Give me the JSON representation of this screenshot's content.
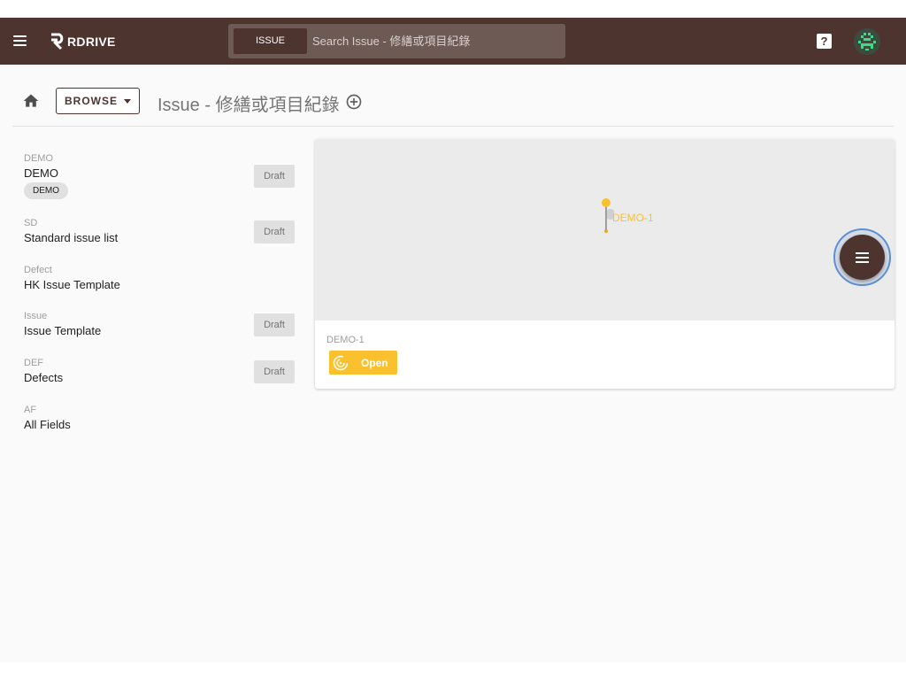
{
  "app": {
    "logo_text": "RDRIVE"
  },
  "search": {
    "scope_label": "ISSUE",
    "placeholder": "Search Issue - 修繕或項目紀錄"
  },
  "help": {
    "label": "?"
  },
  "toolbar": {
    "browse_label": "BROWSE",
    "page_title": "Issue - 修繕或項目紀錄"
  },
  "templates": [
    {
      "code": "DEMO",
      "name": "DEMO",
      "tag": "DEMO",
      "status": "Draft"
    },
    {
      "code": "SD",
      "name": "Standard issue list",
      "status": "Draft"
    },
    {
      "code": "Defect",
      "name": "HK Issue Template"
    },
    {
      "code": "Issue",
      "name": "Issue Template",
      "status": "Draft"
    },
    {
      "code": "DEF",
      "name": "Defects",
      "status": "Draft"
    },
    {
      "code": "AF",
      "name": "All Fields"
    }
  ],
  "issue_card": {
    "pin_label": "DEMO-1",
    "issue_code": "DEMO-1",
    "status": "Open",
    "status_color": "#fbc02d"
  },
  "colors": {
    "primary": "#4e342e",
    "accent": "#fbc02d",
    "focus_ring": "#5b8fd6"
  }
}
